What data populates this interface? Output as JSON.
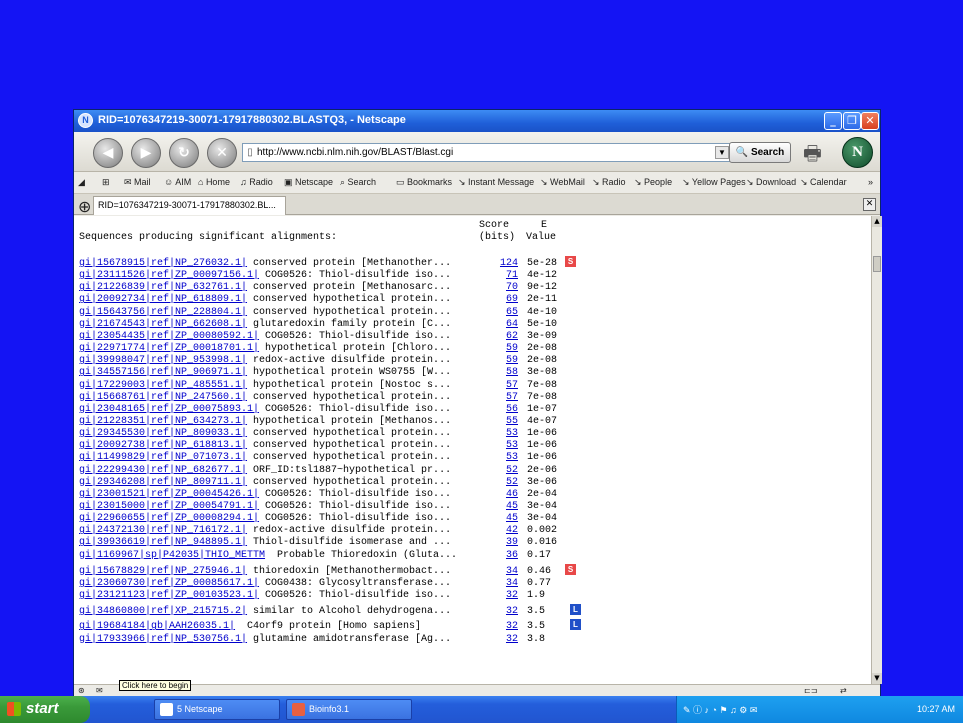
{
  "window": {
    "title": "RID=1076347219-30071-17917880302.BLASTQ3, - Netscape"
  },
  "nav": {
    "url": "http://www.ncbi.nlm.nih.gov/BLAST/Blast.cgi",
    "search_label": "Search",
    "back_icon": "back-arrow-icon",
    "forward_icon": "forward-arrow-icon"
  },
  "bookmarks": [
    {
      "label": "Mail",
      "icon": "mail-icon"
    },
    {
      "label": "AIM",
      "icon": "aim-icon"
    },
    {
      "label": "Home",
      "icon": "home-icon"
    },
    {
      "label": "Radio",
      "icon": "radio-icon"
    },
    {
      "label": "Netscape",
      "icon": "netscape-icon"
    },
    {
      "label": "Search",
      "icon": "search-icon"
    },
    {
      "label": "Bookmarks",
      "icon": "bookmarks-icon"
    },
    {
      "label": "Instant Message",
      "icon": "link-icon"
    },
    {
      "label": "WebMail",
      "icon": "link-icon"
    },
    {
      "label": "Radio",
      "icon": "link-icon"
    },
    {
      "label": "People",
      "icon": "link-icon"
    },
    {
      "label": "Yellow Pages",
      "icon": "link-icon"
    },
    {
      "label": "Download",
      "icon": "link-icon"
    },
    {
      "label": "Calendar",
      "icon": "link-icon"
    }
  ],
  "tab": {
    "label": "RID=1076347219-30071-17917880302.BL..."
  },
  "results": {
    "header_score_1": "Score",
    "header_e_1": "E",
    "header_title": "Sequences producing significant alignments:",
    "header_score_2": "(bits)",
    "header_e_2": "Value",
    "rows": [
      {
        "id": "gi|15678915|ref|NP_276032.1|",
        "desc": " conserved protein [Methanother...",
        "score": "124",
        "evalue": "5e-28",
        "badge": "S"
      },
      {
        "id": "gi|23111526|ref|ZP_00097156.1|",
        "desc": " COG0526: Thiol-disulfide iso...",
        "score": "71",
        "evalue": "4e-12",
        "badge": ""
      },
      {
        "id": "gi|21226839|ref|NP_632761.1|",
        "desc": " conserved protein [Methanosarc...",
        "score": "70",
        "evalue": "9e-12",
        "badge": ""
      },
      {
        "id": "gi|20092734|ref|NP_618809.1|",
        "desc": " conserved hypothetical protein...",
        "score": "69",
        "evalue": "2e-11",
        "badge": ""
      },
      {
        "id": "gi|15643756|ref|NP_228804.1|",
        "desc": " conserved hypothetical protein...",
        "score": "65",
        "evalue": "4e-10",
        "badge": ""
      },
      {
        "id": "gi|21674543|ref|NP_662608.1|",
        "desc": " glutaredoxin family protein [C...",
        "score": "64",
        "evalue": "5e-10",
        "badge": ""
      },
      {
        "id": "gi|23054435|ref|ZP_00080592.1|",
        "desc": " COG0526: Thiol-disulfide iso...",
        "score": "62",
        "evalue": "3e-09",
        "badge": ""
      },
      {
        "id": "gi|22971774|ref|ZP_00018701.1|",
        "desc": " hypothetical protein [Chloro...",
        "score": "59",
        "evalue": "2e-08",
        "badge": ""
      },
      {
        "id": "gi|39998047|ref|NP_953998.1|",
        "desc": " redox-active disulfide protein...",
        "score": "59",
        "evalue": "2e-08",
        "badge": ""
      },
      {
        "id": "gi|34557156|ref|NP_906971.1|",
        "desc": " hypothetical protein WS0755 [W...",
        "score": "58",
        "evalue": "3e-08",
        "badge": ""
      },
      {
        "id": "gi|17229003|ref|NP_485551.1|",
        "desc": " hypothetical protein [Nostoc s...",
        "score": "57",
        "evalue": "7e-08",
        "badge": ""
      },
      {
        "id": "gi|15668761|ref|NP_247560.1|",
        "desc": " conserved hypothetical protein...",
        "score": "57",
        "evalue": "7e-08",
        "badge": ""
      },
      {
        "id": "gi|23048165|ref|ZP_00075893.1|",
        "desc": " COG0526: Thiol-disulfide iso...",
        "score": "56",
        "evalue": "1e-07",
        "badge": ""
      },
      {
        "id": "gi|21228351|ref|NP_634273.1|",
        "desc": " hypothetical protein [Methanos...",
        "score": "55",
        "evalue": "4e-07",
        "badge": ""
      },
      {
        "id": "gi|29345530|ref|NP_809033.1|",
        "desc": " conserved hypothetical protein...",
        "score": "53",
        "evalue": "1e-06",
        "badge": ""
      },
      {
        "id": "gi|20092738|ref|NP_618813.1|",
        "desc": " conserved hypothetical protein...",
        "score": "53",
        "evalue": "1e-06",
        "badge": ""
      },
      {
        "id": "gi|11499829|ref|NP_071073.1|",
        "desc": " conserved hypothetical protein...",
        "score": "53",
        "evalue": "1e-06",
        "badge": ""
      },
      {
        "id": "gi|22299430|ref|NP_682677.1|",
        "desc": " ORF_ID:tsl1887~hypothetical pr...",
        "score": "52",
        "evalue": "2e-06",
        "badge": ""
      },
      {
        "id": "gi|29346208|ref|NP_809711.1|",
        "desc": " conserved hypothetical protein...",
        "score": "52",
        "evalue": "3e-06",
        "badge": ""
      },
      {
        "id": "gi|23001521|ref|ZP_00045426.1|",
        "desc": " COG0526: Thiol-disulfide iso...",
        "score": "46",
        "evalue": "2e-04",
        "badge": ""
      },
      {
        "id": "gi|23015000|ref|ZP_00054791.1|",
        "desc": " COG0526: Thiol-disulfide iso...",
        "score": "45",
        "evalue": "3e-04",
        "badge": ""
      },
      {
        "id": "gi|22960655|ref|ZP_00008294.1|",
        "desc": " COG0526: Thiol-disulfide iso...",
        "score": "45",
        "evalue": "3e-04",
        "badge": ""
      },
      {
        "id": "gi|24372130|ref|NP_716172.1|",
        "desc": " redox-active disulfide protein...",
        "score": "42",
        "evalue": "0.002",
        "badge": ""
      },
      {
        "id": "gi|39936619|ref|NP_948895.1|",
        "desc": " Thiol-disulfide isomerase and ...",
        "score": "39",
        "evalue": "0.016",
        "badge": ""
      },
      {
        "id": "gi|1169967|sp|P42035|THIO_METTM",
        "desc": "  Probable Thioredoxin (Gluta...",
        "score": "36",
        "evalue": "0.17",
        "badge": ""
      },
      {
        "id": "gi|15678829|ref|NP_275946.1|",
        "desc": " thioredoxin [Methanothermobact...",
        "score": "34",
        "evalue": "0.46",
        "badge": "S"
      },
      {
        "id": "gi|23060730|ref|ZP_00085617.1|",
        "desc": " COG0438: Glycosyltransferase...",
        "score": "34",
        "evalue": "0.77",
        "badge": ""
      },
      {
        "id": "gi|23121123|ref|ZP_00103523.1|",
        "desc": " COG0526: Thiol-disulfide iso...",
        "score": "32",
        "evalue": "1.9",
        "badge": ""
      },
      {
        "id": "gi|34860800|ref|XP_215715.2|",
        "desc": " similar to Alcohol dehydrogena...",
        "score": "32",
        "evalue": "3.5",
        "badge": "L"
      },
      {
        "id": "gi|19684184|gb|AAH26035.1|",
        "desc": "  C4orf9 protein [Homo sapiens]",
        "score": "32",
        "evalue": "3.5",
        "badge": "L"
      },
      {
        "id": "gi|17933966|ref|NP_530756.1|",
        "desc": " glutamine amidotransferase [Ag...",
        "score": "32",
        "evalue": "3.8",
        "badge": ""
      }
    ]
  },
  "status": {
    "tooltip": "Click here to begin"
  },
  "taskbar": {
    "start_label": "start",
    "tasks": [
      {
        "label": "5 Netscape",
        "icon": "netscape-icon"
      },
      {
        "label": "Bioinfo3.1",
        "icon": "powerpoint-icon"
      }
    ],
    "clock": "10:27 AM"
  }
}
